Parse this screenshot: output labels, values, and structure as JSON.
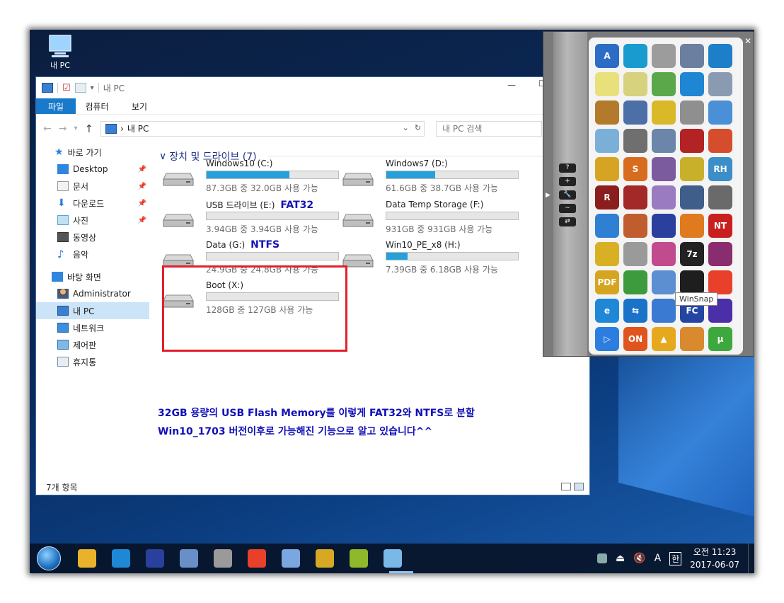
{
  "desktop": {
    "icon_label": "내 PC"
  },
  "explorer": {
    "title": "내 PC",
    "tabs": {
      "file": "파일",
      "computer": "컴퓨터",
      "view": "보기"
    },
    "address": "내 PC",
    "search_placeholder": "내 PC 검색",
    "group_title": "장치 및 드라이브 (7)",
    "status": "7개 항목"
  },
  "sidebar": {
    "quick_access": "바로 가기",
    "items": [
      "Desktop",
      "문서",
      "다운로드",
      "사진",
      "동영상",
      "음악"
    ],
    "desktop": "바탕 화면",
    "user": "Administrator",
    "this_pc": "내 PC",
    "network": "네트워크",
    "control_panel": "제어판",
    "recycle": "휴지통"
  },
  "drives": [
    {
      "name": "Windows10 (C:)",
      "info": "87.3GB 중 32.0GB 사용 가능",
      "used": 0.63,
      "annotation": ""
    },
    {
      "name": "Windows7 (D:)",
      "info": "61.6GB 중 38.7GB 사용 가능",
      "used": 0.37,
      "annotation": ""
    },
    {
      "name": "USB 드라이브 (E:)",
      "info": "3.94GB 중 3.94GB 사용 가능",
      "used": 0.0,
      "annotation": "FAT32"
    },
    {
      "name": "Data Temp Storage (F:)",
      "info": "931GB 중 931GB 사용 가능",
      "used": 0.0,
      "annotation": ""
    },
    {
      "name": "Data (G:)",
      "info": "24.9GB 중 24.8GB 사용 가능",
      "used": 0.0,
      "annotation": "NTFS"
    },
    {
      "name": "Win10_PE_x8 (H:)",
      "info": "7.39GB 중 6.18GB 사용 가능",
      "used": 0.16,
      "annotation": ""
    },
    {
      "name": "Boot (X:)",
      "info": "128GB 중 127GB 사용 가능",
      "used": 0.0,
      "annotation": ""
    }
  ],
  "note": {
    "line1": "32GB 용량의 USB Flash Memory를 이렇게 FAT32와 NTFS로 분할",
    "line2": "Win10_1703 버전이후로 가능해진 기능으로 알고 있습니다^^"
  },
  "launcher": {
    "tooltip": "WinSnap",
    "buttons": [
      "?",
      "+",
      "🔧",
      "~",
      "⇄"
    ],
    "icons": [
      {
        "name": "a-icon",
        "color": "#2b6cc4",
        "glyph": "A"
      },
      {
        "name": "sync-icon",
        "color": "#1a9bd0",
        "glyph": ""
      },
      {
        "name": "drive-icon",
        "color": "#9c9c9c",
        "glyph": ""
      },
      {
        "name": "snap-icon",
        "color": "#6b7fa0",
        "glyph": ""
      },
      {
        "name": "backup-icon",
        "color": "#1e7fc9",
        "glyph": ""
      },
      {
        "name": "ghost-icon",
        "color": "#e8e07a",
        "glyph": ""
      },
      {
        "name": "ghost-search-icon",
        "color": "#d7d27e",
        "glyph": ""
      },
      {
        "name": "ghost-play-icon",
        "color": "#5aa84a",
        "glyph": ""
      },
      {
        "name": "windows-icon",
        "color": "#1f86d3",
        "glyph": ""
      },
      {
        "name": "hardware-icon",
        "color": "#8a9bb1",
        "glyph": ""
      },
      {
        "name": "cd-icon",
        "color": "#b37a2b",
        "glyph": ""
      },
      {
        "name": "settings-icon",
        "color": "#4d6fa8",
        "glyph": ""
      },
      {
        "name": "gear-icon",
        "color": "#d9b928",
        "glyph": ""
      },
      {
        "name": "usb-icon",
        "color": "#8f8f8f",
        "glyph": ""
      },
      {
        "name": "pipe-icon",
        "color": "#4b8fd6",
        "glyph": ""
      },
      {
        "name": "doc-icon",
        "color": "#7ab0d8",
        "glyph": ""
      },
      {
        "name": "floppy-icon",
        "color": "#6f6f6f",
        "glyph": ""
      },
      {
        "name": "computer-icon",
        "color": "#6b86a8",
        "glyph": ""
      },
      {
        "name": "ladybug-icon",
        "color": "#b42323",
        "glyph": ""
      },
      {
        "name": "chart-icon",
        "color": "#d64d2e",
        "glyph": ""
      },
      {
        "name": "tools-icon",
        "color": "#d6a323",
        "glyph": ""
      },
      {
        "name": "s-icon",
        "color": "#d86c1e",
        "glyph": "S"
      },
      {
        "name": "image-icon",
        "color": "#7b5a9e",
        "glyph": ""
      },
      {
        "name": "puzzle-icon",
        "color": "#c9b02a",
        "glyph": ""
      },
      {
        "name": "rh-icon",
        "color": "#3b8ec8",
        "glyph": "RH"
      },
      {
        "name": "r-icon",
        "color": "#8a1d1d",
        "glyph": "R"
      },
      {
        "name": "cubes-icon",
        "color": "#a32828",
        "glyph": ""
      },
      {
        "name": "disc-icon",
        "color": "#9a7bc2",
        "glyph": ""
      },
      {
        "name": "hdd-icon",
        "color": "#3f5f8a",
        "glyph": ""
      },
      {
        "name": "usb-stick-icon",
        "color": "#6a6a6a",
        "glyph": ""
      },
      {
        "name": "windows-usb-icon",
        "color": "#2f7fd2",
        "glyph": ""
      },
      {
        "name": "install-icon",
        "color": "#c05d2e",
        "glyph": ""
      },
      {
        "name": "save-icon",
        "color": "#2a3f9e",
        "glyph": ""
      },
      {
        "name": "magnifier-icon",
        "color": "#e07a1e",
        "glyph": ""
      },
      {
        "name": "nt-icon",
        "color": "#c8201e",
        "glyph": "NT"
      },
      {
        "name": "key-icon",
        "color": "#d9b024",
        "glyph": ""
      },
      {
        "name": "trash-icon",
        "color": "#9a9a9a",
        "glyph": ""
      },
      {
        "name": "wand-icon",
        "color": "#c24a8e",
        "glyph": ""
      },
      {
        "name": "7z-icon",
        "color": "#222222",
        "glyph": "7z"
      },
      {
        "name": "winrar-icon",
        "color": "#8a2d6e",
        "glyph": ""
      },
      {
        "name": "pdf-icon",
        "color": "#d6a520",
        "glyph": "PDF"
      },
      {
        "name": "pie-icon",
        "color": "#3d9b3d",
        "glyph": ""
      },
      {
        "name": "winsnap-icon",
        "color": "#5c8ed2",
        "glyph": ""
      },
      {
        "name": "monitor-icon",
        "color": "#1e1e1e",
        "glyph": ""
      },
      {
        "name": "color-icon",
        "color": "#e8402a",
        "glyph": ""
      },
      {
        "name": "ie-icon",
        "color": "#1e88d6",
        "glyph": "e"
      },
      {
        "name": "teamviewer-icon",
        "color": "#1a72c9",
        "glyph": "⇆"
      },
      {
        "name": "network-icon",
        "color": "#3a7ad2",
        "glyph": ""
      },
      {
        "name": "fc-icon",
        "color": "#2446a3",
        "glyph": "FC"
      },
      {
        "name": "chip-icon",
        "color": "#4a2fa8",
        "glyph": ""
      },
      {
        "name": "play-icon",
        "color": "#2b7de0",
        "glyph": "▷"
      },
      {
        "name": "on-icon",
        "color": "#e0541e",
        "glyph": "ON"
      },
      {
        "name": "aimp-icon",
        "color": "#e6a91e",
        "glyph": "▲"
      },
      {
        "name": "face-icon",
        "color": "#d98a2e",
        "glyph": ""
      },
      {
        "name": "utorrent-icon",
        "color": "#3da83d",
        "glyph": "µ"
      }
    ]
  },
  "taskbar": {
    "time": "오전 11:23",
    "date": "2017-06-07",
    "ime": "A",
    "lang": "한",
    "icons": [
      {
        "name": "file-explorer-icon",
        "color": "#e8b32a"
      },
      {
        "name": "ie-taskbar-icon",
        "color": "#1e88d6"
      },
      {
        "name": "save-taskbar-icon",
        "color": "#2a3f9e"
      },
      {
        "name": "search-taskbar-icon",
        "color": "#6a8fc8"
      },
      {
        "name": "ghost-taskbar-icon",
        "color": "#9a9a9a"
      },
      {
        "name": "color-taskbar-icon",
        "color": "#e8402a"
      },
      {
        "name": "network-taskbar-icon",
        "color": "#7aa7e0"
      },
      {
        "name": "r-taskbar-icon",
        "color": "#d6a823"
      },
      {
        "name": "olive-taskbar-icon",
        "color": "#8fb82a"
      },
      {
        "name": "laptop-taskbar-icon",
        "color": "#7ab8e8"
      }
    ]
  }
}
